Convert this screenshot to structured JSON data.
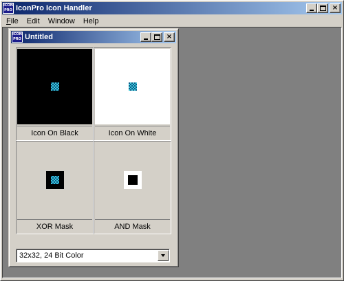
{
  "app": {
    "title": "IconPro Icon Handler",
    "icon_text_top": "ICON",
    "icon_text_bottom": "PRO",
    "minimize_label": "_",
    "close_label": "×"
  },
  "menu": {
    "items": [
      {
        "underline": "F",
        "rest": "ile"
      },
      {
        "underline": "",
        "rest": "Edit"
      },
      {
        "underline": "",
        "rest": "Window"
      },
      {
        "underline": "",
        "rest": "Help"
      }
    ]
  },
  "document": {
    "title": "Untitled",
    "icon_text_top": "ICON",
    "icon_text_bottom": "PRO"
  },
  "previews": {
    "on_black": "Icon On Black",
    "on_white": "Icon On White",
    "xor_mask": "XOR Mask",
    "and_mask": "AND Mask"
  },
  "format_select": {
    "value": "32x32, 24 Bit Color"
  },
  "colors": {
    "titlebar_start": "#0a246a",
    "titlebar_end": "#a6caf0",
    "workspace": "#808080",
    "face": "#d4d0c8"
  }
}
